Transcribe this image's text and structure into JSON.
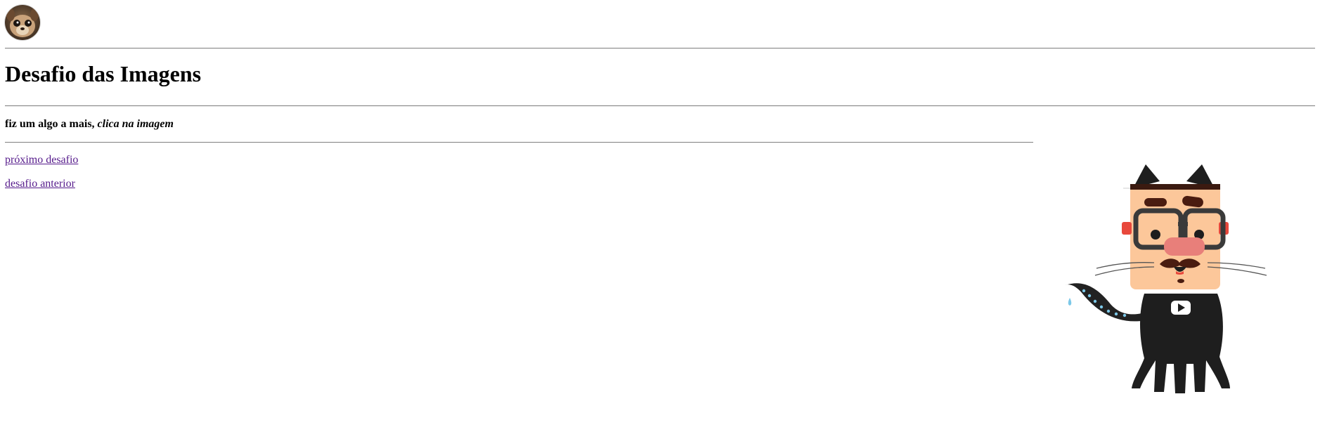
{
  "header": {
    "avatar_icon": "dog-avatar-icon"
  },
  "main": {
    "title": "Desafio das Imagens",
    "note_bold": "fiz um algo a mais, ",
    "note_italic": "clica na imagem"
  },
  "links": {
    "next": "próximo desafio",
    "previous": "desafio anterior"
  },
  "image": {
    "icon": "octocat-icon"
  },
  "colors": {
    "visited_link": "#551a8b",
    "rule": "#888888"
  }
}
